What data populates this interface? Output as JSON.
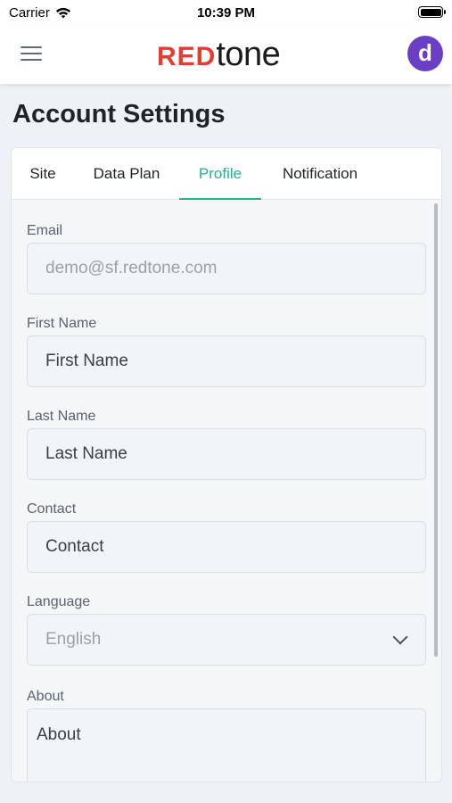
{
  "status_bar": {
    "carrier": "Carrier",
    "time": "10:39 PM",
    "battery_level": 1.0
  },
  "header": {
    "logo_red": "RED",
    "logo_tone": "tone",
    "avatar_initial": "d",
    "menu_icon": "hamburger-menu-icon",
    "colors": {
      "brand_red": "#e63b2e",
      "avatar": "#6a3fc6"
    }
  },
  "page": {
    "title": "Account Settings"
  },
  "tabs": [
    {
      "label": "Site",
      "active": false
    },
    {
      "label": "Data Plan",
      "active": false
    },
    {
      "label": "Profile",
      "active": true
    },
    {
      "label": "Notification",
      "active": false
    }
  ],
  "accent_color": "#1fb58c",
  "form": {
    "email": {
      "label": "Email",
      "value": "demo@sf.redtone.com",
      "disabled": true
    },
    "first_name": {
      "label": "First Name",
      "placeholder": "First Name"
    },
    "last_name": {
      "label": "Last Name",
      "placeholder": "Last Name"
    },
    "contact": {
      "label": "Contact",
      "placeholder": "Contact"
    },
    "language": {
      "label": "Language",
      "value": "English",
      "icon": "chevron-down-icon"
    },
    "about": {
      "label": "About",
      "placeholder": "About"
    }
  }
}
